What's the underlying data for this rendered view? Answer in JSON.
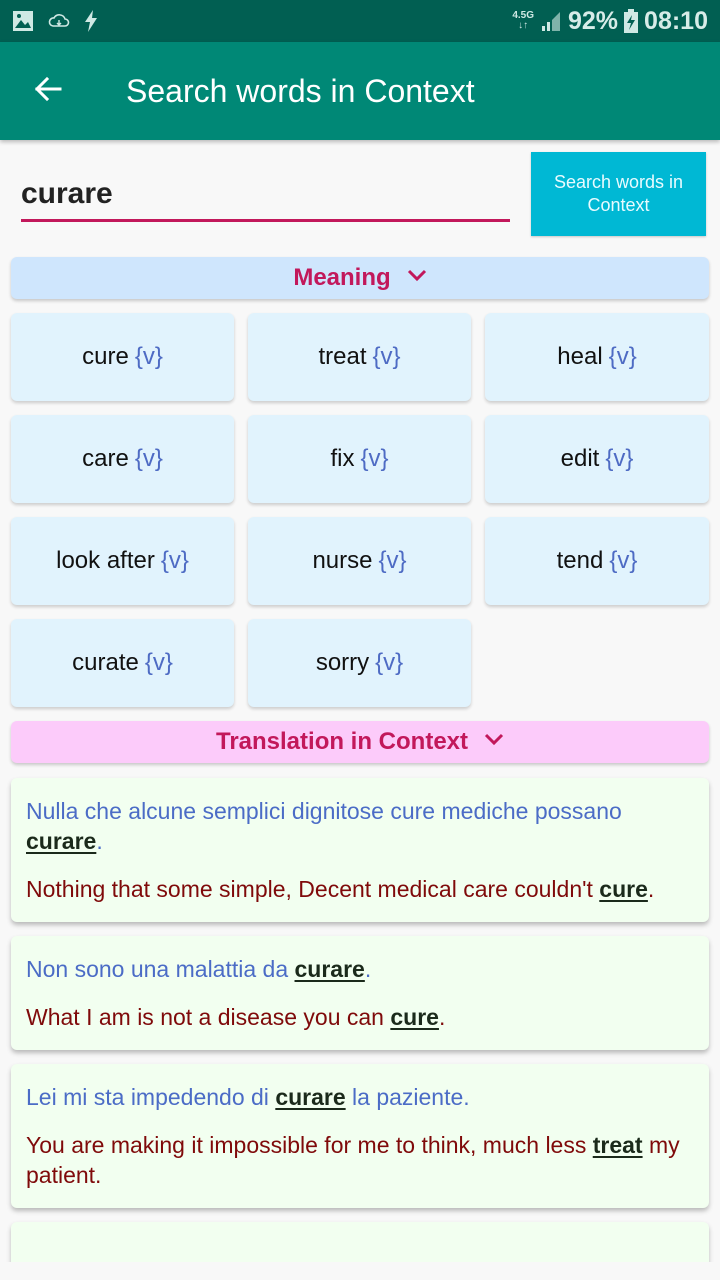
{
  "status_bar": {
    "icons_left": [
      "image-icon",
      "cloud-sync-icon",
      "flash-icon"
    ],
    "network": "4.5G",
    "battery_percent": "92%",
    "time": "08:10"
  },
  "toolbar": {
    "title": "Search words in Context",
    "back_icon": "arrow-left-icon"
  },
  "search": {
    "value": "curare",
    "placeholder": "",
    "button_label": "Search words in Context"
  },
  "meaning": {
    "header": "Meaning",
    "items": [
      {
        "word": "cure",
        "pos": "{v}"
      },
      {
        "word": "treat",
        "pos": "{v}"
      },
      {
        "word": "heal",
        "pos": "{v}"
      },
      {
        "word": "care",
        "pos": "{v}"
      },
      {
        "word": "fix",
        "pos": "{v}"
      },
      {
        "word": "edit",
        "pos": "{v}"
      },
      {
        "word": "look after",
        "pos": "{v}"
      },
      {
        "word": "nurse",
        "pos": "{v}"
      },
      {
        "word": "tend",
        "pos": "{v}"
      },
      {
        "word": "curate",
        "pos": "{v}"
      },
      {
        "word": "sorry",
        "pos": "{v}"
      }
    ]
  },
  "translation": {
    "header": "Translation in Context",
    "examples": [
      {
        "src_before": "Nulla che alcune semplici dignitose cure mediche possano ",
        "src_hl": "curare",
        "src_after": ".",
        "tgt_before": "Nothing that some simple, Decent medical care couldn't ",
        "tgt_hl": "cure",
        "tgt_after": "."
      },
      {
        "src_before": "Non sono una malattia da ",
        "src_hl": "curare",
        "src_after": ".",
        "tgt_before": "What I am is not a disease you can ",
        "tgt_hl": "cure",
        "tgt_after": "."
      },
      {
        "src_before": "Lei mi sta impedendo di ",
        "src_hl": "curare",
        "src_after": " la paziente.",
        "tgt_before": "You are making it impossible for me to think, much less ",
        "tgt_hl": "treat",
        "tgt_after": " my patient."
      }
    ]
  },
  "colors": {
    "status_bar": "#015f52",
    "toolbar": "#008876",
    "accent": "#c2185b",
    "search_button": "#00b8d4",
    "meaning_header_bg": "#cfe6fd",
    "translation_header_bg": "#fccbfa",
    "chip_bg": "#e1f3fd",
    "card_bg": "#f2fff0",
    "source_text": "#4b6cc6",
    "target_text": "#7f0a0a"
  }
}
